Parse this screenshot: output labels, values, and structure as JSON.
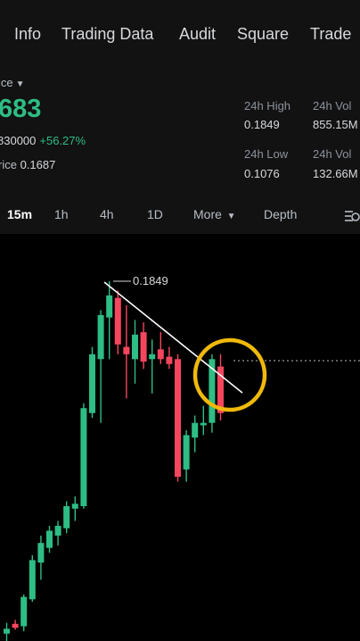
{
  "tabs": [
    "Info",
    "Trading Data",
    "Audit",
    "Square",
    "Trade"
  ],
  "price": {
    "label": "ice",
    "value": "683",
    "cny": "830000",
    "change": "+56.27%",
    "mark_label": "rice",
    "mark_value": "0.1687"
  },
  "stats": {
    "high_label": "24h High",
    "high_value": "0.1849",
    "vol1_label": "24h Vol",
    "vol1_value": "855.15M",
    "low_label": "24h Low",
    "low_value": "0.1076",
    "vol2_label": "24h Vol",
    "vol2_value": "132.66M"
  },
  "intervals": {
    "i15m": "15m",
    "i1h": "1h",
    "i4h": "4h",
    "i1d": "1D",
    "more": "More",
    "depth": "Depth"
  },
  "colors": {
    "up": "#2ebd85",
    "down": "#f6465d",
    "highlight": "#f0b90b"
  },
  "chart_data": {
    "type": "candlestick",
    "annotation_high": "0.1849",
    "candles": [
      {
        "o": 0.113,
        "h": 0.1152,
        "l": 0.1115,
        "c": 0.114
      },
      {
        "o": 0.115,
        "h": 0.1158,
        "l": 0.1138,
        "c": 0.1142
      },
      {
        "o": 0.1145,
        "h": 0.121,
        "l": 0.1135,
        "c": 0.1205
      },
      {
        "o": 0.12,
        "h": 0.129,
        "l": 0.1195,
        "c": 0.128
      },
      {
        "o": 0.1275,
        "h": 0.133,
        "l": 0.124,
        "c": 0.1315
      },
      {
        "o": 0.1305,
        "h": 0.135,
        "l": 0.1295,
        "c": 0.134
      },
      {
        "o": 0.133,
        "h": 0.136,
        "l": 0.131,
        "c": 0.135
      },
      {
        "o": 0.1345,
        "h": 0.14,
        "l": 0.1335,
        "c": 0.139
      },
      {
        "o": 0.1385,
        "h": 0.141,
        "l": 0.136,
        "c": 0.1395
      },
      {
        "o": 0.139,
        "h": 0.16,
        "l": 0.1385,
        "c": 0.159
      },
      {
        "o": 0.158,
        "h": 0.1715,
        "l": 0.157,
        "c": 0.17
      },
      {
        "o": 0.169,
        "h": 0.179,
        "l": 0.156,
        "c": 0.178
      },
      {
        "o": 0.1775,
        "h": 0.1849,
        "l": 0.169,
        "c": 0.182
      },
      {
        "o": 0.1815,
        "h": 0.183,
        "l": 0.17,
        "c": 0.172
      },
      {
        "o": 0.1715,
        "h": 0.18,
        "l": 0.161,
        "c": 0.17
      },
      {
        "o": 0.169,
        "h": 0.177,
        "l": 0.164,
        "c": 0.174
      },
      {
        "o": 0.1745,
        "h": 0.1765,
        "l": 0.167,
        "c": 0.1685
      },
      {
        "o": 0.169,
        "h": 0.173,
        "l": 0.162,
        "c": 0.17
      },
      {
        "o": 0.171,
        "h": 0.1745,
        "l": 0.168,
        "c": 0.169
      },
      {
        "o": 0.1695,
        "h": 0.1715,
        "l": 0.167,
        "c": 0.168
      },
      {
        "o": 0.169,
        "h": 0.17,
        "l": 0.144,
        "c": 0.145
      },
      {
        "o": 0.1465,
        "h": 0.1545,
        "l": 0.144,
        "c": 0.1535
      },
      {
        "o": 0.153,
        "h": 0.1575,
        "l": 0.15,
        "c": 0.156
      },
      {
        "o": 0.1555,
        "h": 0.1595,
        "l": 0.1535,
        "c": 0.156
      },
      {
        "o": 0.156,
        "h": 0.17,
        "l": 0.154,
        "c": 0.169
      },
      {
        "o": 0.1675,
        "h": 0.17,
        "l": 0.1565,
        "c": 0.158
      }
    ],
    "last_price": 0.1687
  }
}
